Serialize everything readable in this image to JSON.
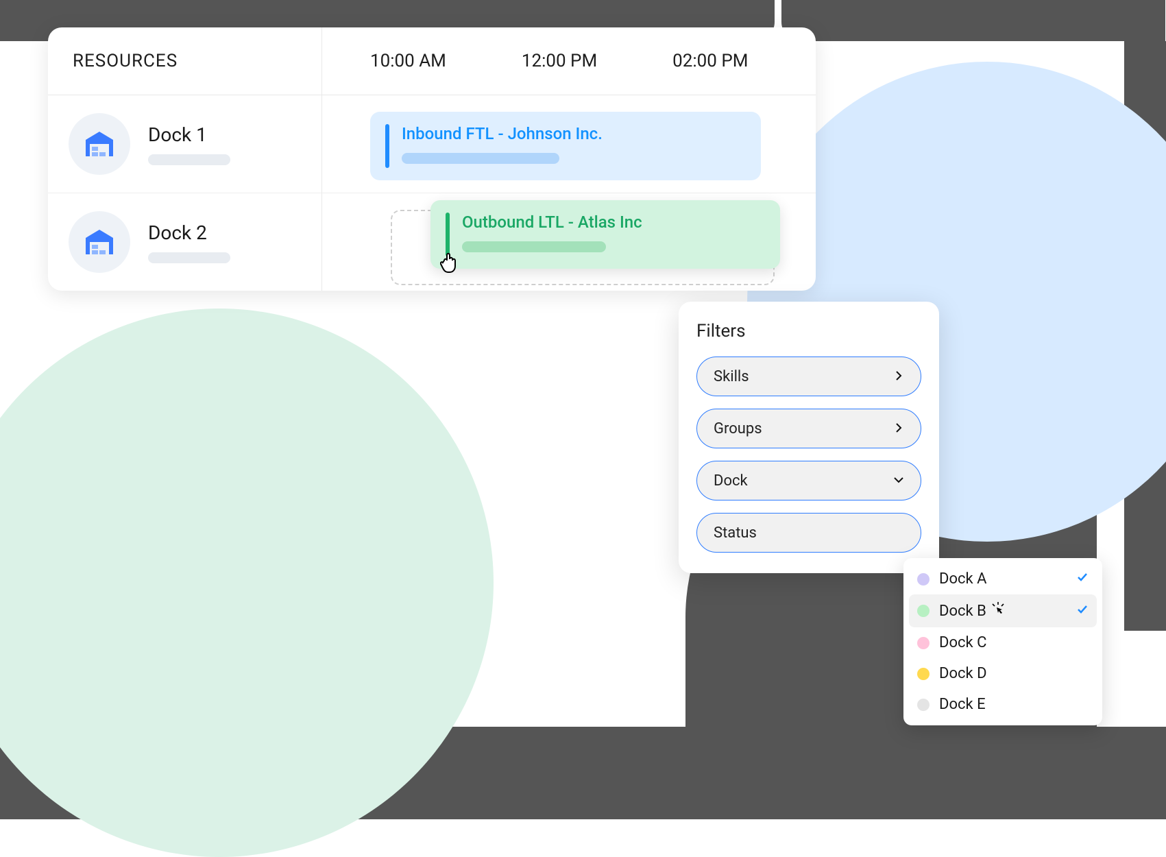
{
  "schedule": {
    "header": {
      "resources_label": "RESOURCES",
      "times": [
        "10:00 AM",
        "12:00 PM",
        "02:00 PM"
      ]
    },
    "rows": [
      {
        "name": "Dock 1",
        "event": {
          "title": "Inbound FTL - Johnson Inc."
        }
      },
      {
        "name": "Dock 2",
        "event": {
          "title": "Outbound LTL - Atlas Inc"
        }
      }
    ]
  },
  "filters": {
    "title": "Filters",
    "items": [
      {
        "label": "Skills",
        "expanded": false
      },
      {
        "label": "Groups",
        "expanded": false
      },
      {
        "label": "Dock",
        "expanded": true
      },
      {
        "label": "Status",
        "expanded": false
      }
    ]
  },
  "dock_dropdown": {
    "options": [
      {
        "label": "Dock A",
        "color": "#cfc8f7",
        "selected": true,
        "hovered": false
      },
      {
        "label": "Dock B",
        "color": "#b7f0c2",
        "selected": true,
        "hovered": true
      },
      {
        "label": "Dock C",
        "color": "#ffc2da",
        "selected": false,
        "hovered": false
      },
      {
        "label": "Dock D",
        "color": "#ffd94f",
        "selected": false,
        "hovered": false
      },
      {
        "label": "Dock E",
        "color": "#e4e4e4",
        "selected": false,
        "hovered": false
      }
    ]
  }
}
